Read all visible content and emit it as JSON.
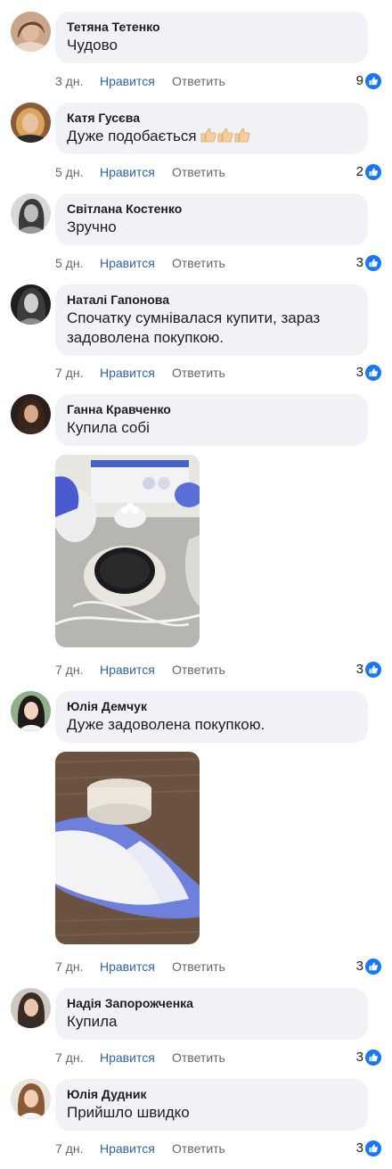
{
  "labels": {
    "like": "Нравится",
    "reply": "Ответить"
  },
  "comments": [
    {
      "author": "Тетяна Тетенко",
      "text": "Чудово",
      "time": "3 дн.",
      "likes": "9"
    },
    {
      "author": "Катя Гусєва",
      "text": "Дуже подобається",
      "time": "5 дн.",
      "likes": "2"
    },
    {
      "author": "Світлана Костенко",
      "text": "Зручно",
      "time": "5 дн.",
      "likes": "3"
    },
    {
      "author": "Наталі Гапонова",
      "text": "Спочатку сумнівалася купити, зараз задоволена покупкою.",
      "time": "7 дн.",
      "likes": "3"
    },
    {
      "author": "Ганна Кравченко",
      "text": "Купила собі",
      "time": "7 дн.",
      "likes": "3"
    },
    {
      "author": "Юлія Демчук",
      "text": "Дуже задоволена покупкою.",
      "time": "7 дн.",
      "likes": "3"
    },
    {
      "author": "Надія Запорожченка",
      "text": "Купила",
      "time": "7 дн.",
      "likes": "3"
    },
    {
      "author": "Юлія Дудник",
      "text": "Прийшло швидко",
      "time": "7 дн.",
      "likes": "3"
    }
  ],
  "colors": {
    "bubble": "#f0f2f5",
    "like_link": "#2d63b6",
    "muted": "#65676b",
    "like_badge": "#1877f2"
  },
  "icons": {
    "reaction": "like-thumb-icon",
    "emoji": "thumbs-up-emoji"
  }
}
